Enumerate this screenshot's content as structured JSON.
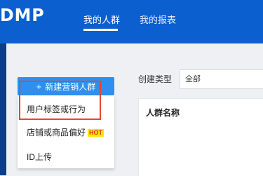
{
  "header": {
    "logo_text": "DMP",
    "nav": [
      {
        "label": "我的人群",
        "active": true
      },
      {
        "label": "我的报表",
        "active": false
      }
    ]
  },
  "sidebar": {
    "new_button_label": "新建营销人群",
    "new_button_icon": "plus-icon",
    "menu": [
      {
        "label": "用户标签或行为"
      },
      {
        "label": "店铺或商品偏好",
        "badge": "HOT"
      },
      {
        "label": "ID上传"
      }
    ]
  },
  "filter": {
    "label": "创建类型",
    "value": "全部"
  },
  "table": {
    "columns": [
      "人群名称"
    ]
  },
  "colors": {
    "brand": "#0b5fcf",
    "primary_button": "#2f8ff0",
    "highlight_frame": "#e8452c",
    "hot_badge_bg": "#ffe600",
    "hot_badge_text": "#e23a19"
  }
}
